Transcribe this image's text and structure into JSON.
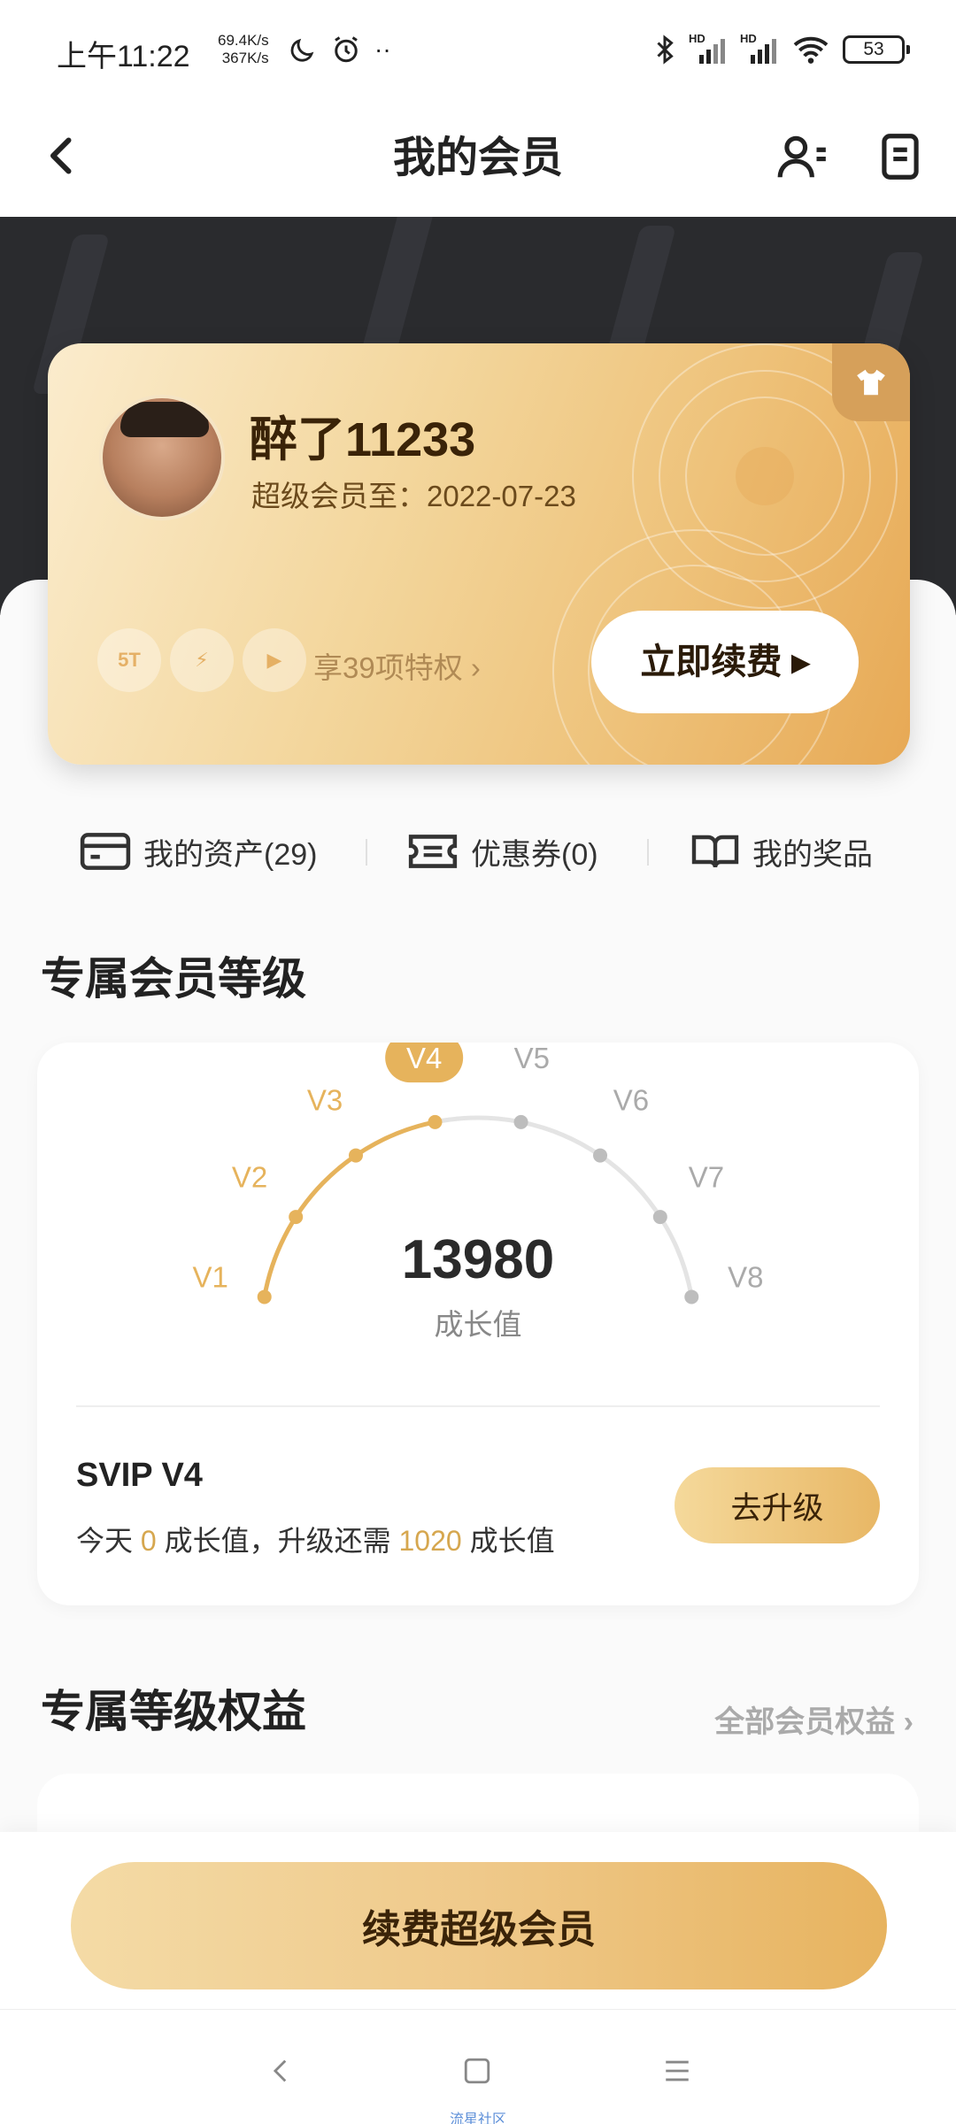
{
  "status_bar": {
    "time": "上午11:22",
    "net_up": "69.4K/s",
    "net_down": "367K/s",
    "battery": "53",
    "signal_label_1": "HD",
    "signal_label_2": "HD"
  },
  "header": {
    "title": "我的会员"
  },
  "member_card": {
    "name": "醉了11233",
    "expiry": "超级会员至：2022-07-23",
    "privilege_badges": [
      "5T",
      "⚡",
      "▶"
    ],
    "privilege_link": "享39项特权",
    "renew_label": "立即续费 ▸"
  },
  "quick_links": [
    {
      "label": "我的资产(29)",
      "icon": "card-icon"
    },
    {
      "label": "优惠券(0)",
      "icon": "ticket-icon"
    },
    {
      "label": "我的奖品",
      "icon": "book-icon"
    }
  ],
  "levels_section": {
    "title": "专属会员等级",
    "levels": [
      "V1",
      "V2",
      "V3",
      "V4",
      "V5",
      "V6",
      "V7",
      "V8"
    ],
    "current_level_index": 3,
    "growth_value": "13980",
    "growth_label": "成长值",
    "svip_level": "SVIP V4",
    "progress_prefix": "今天 ",
    "today_growth": "0",
    "progress_mid": " 成长值，升级还需 ",
    "needed_growth": "1020",
    "progress_suffix": " 成长值",
    "upgrade_label": "去升级"
  },
  "benefits_section": {
    "title": "专属等级权益",
    "all_benefits_link": "全部会员权益 ›"
  },
  "bottom": {
    "renew_super_label": "续费超级会员"
  },
  "nav": {
    "caption": "流星社区"
  },
  "colors": {
    "gold_active": "#e6b35c",
    "gray_inactive": "#bdbdbd",
    "dark_hero": "#2a2b2e"
  }
}
